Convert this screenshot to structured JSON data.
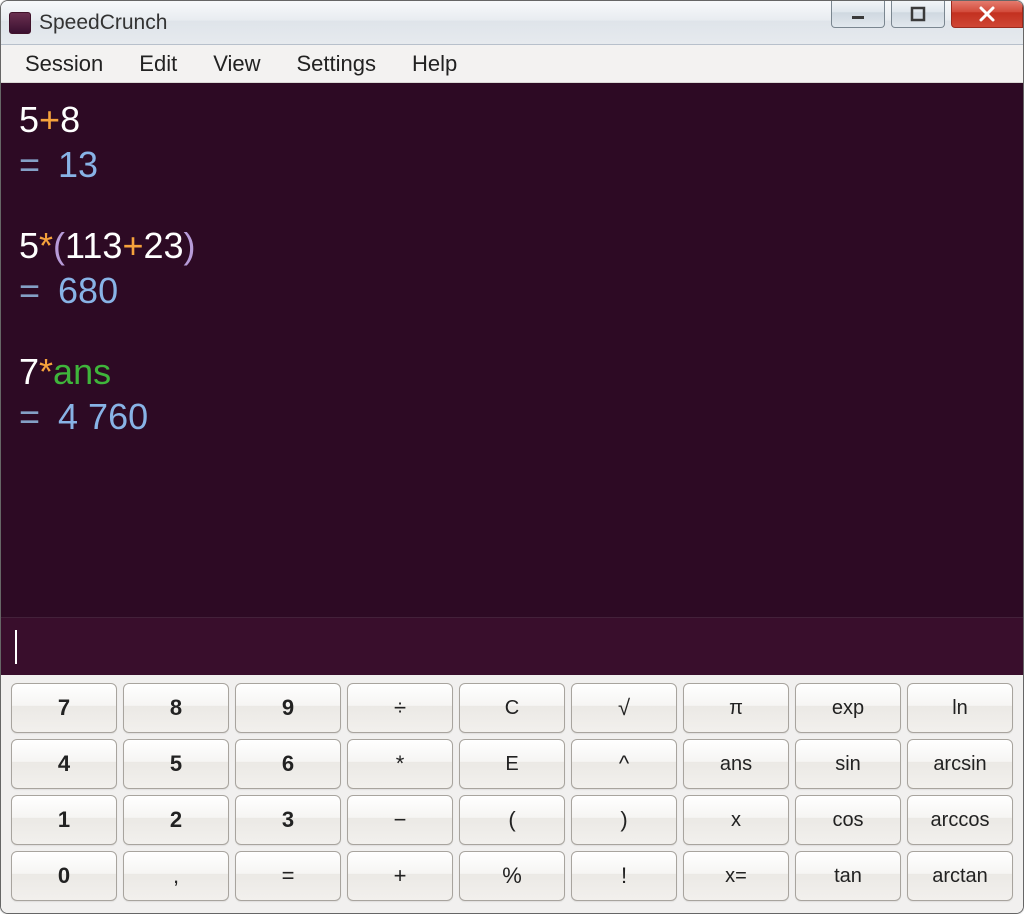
{
  "window": {
    "title": "SpeedCrunch"
  },
  "menubar": [
    "Session",
    "Edit",
    "View",
    "Settings",
    "Help"
  ],
  "history": [
    {
      "expr": [
        {
          "kind": "num",
          "text": "5"
        },
        {
          "kind": "op",
          "text": "+"
        },
        {
          "kind": "num",
          "text": "8"
        }
      ],
      "result": "13"
    },
    {
      "expr": [
        {
          "kind": "num",
          "text": "5"
        },
        {
          "kind": "op",
          "text": "*"
        },
        {
          "kind": "par",
          "text": "("
        },
        {
          "kind": "num",
          "text": "113"
        },
        {
          "kind": "op",
          "text": "+"
        },
        {
          "kind": "num",
          "text": "23"
        },
        {
          "kind": "par",
          "text": ")"
        }
      ],
      "result": "680"
    },
    {
      "expr": [
        {
          "kind": "num",
          "text": "7"
        },
        {
          "kind": "op",
          "text": "*"
        },
        {
          "kind": "var",
          "text": "ans"
        }
      ],
      "result": "4 760"
    }
  ],
  "input": "",
  "keypad": [
    [
      {
        "label": "7",
        "name": "key-7",
        "cls": "num"
      },
      {
        "label": "8",
        "name": "key-8",
        "cls": "num"
      },
      {
        "label": "9",
        "name": "key-9",
        "cls": "num"
      },
      {
        "label": "÷",
        "name": "key-divide",
        "cls": "op"
      },
      {
        "label": "C",
        "name": "key-clear",
        "cls": "fn"
      },
      {
        "label": "√",
        "name": "key-sqrt",
        "cls": "op"
      },
      {
        "label": "π",
        "name": "key-pi",
        "cls": "fn"
      },
      {
        "label": "exp",
        "name": "key-exp",
        "cls": "fn"
      },
      {
        "label": "ln",
        "name": "key-ln",
        "cls": "fn"
      }
    ],
    [
      {
        "label": "4",
        "name": "key-4",
        "cls": "num"
      },
      {
        "label": "5",
        "name": "key-5",
        "cls": "num"
      },
      {
        "label": "6",
        "name": "key-6",
        "cls": "num"
      },
      {
        "label": "*",
        "name": "key-multiply",
        "cls": "op"
      },
      {
        "label": "E",
        "name": "key-e",
        "cls": "fn"
      },
      {
        "label": "^",
        "name": "key-power",
        "cls": "op"
      },
      {
        "label": "ans",
        "name": "key-ans",
        "cls": "fn"
      },
      {
        "label": "sin",
        "name": "key-sin",
        "cls": "fn"
      },
      {
        "label": "arcsin",
        "name": "key-arcsin",
        "cls": "fn"
      }
    ],
    [
      {
        "label": "1",
        "name": "key-1",
        "cls": "num"
      },
      {
        "label": "2",
        "name": "key-2",
        "cls": "num"
      },
      {
        "label": "3",
        "name": "key-3",
        "cls": "num"
      },
      {
        "label": "−",
        "name": "key-minus",
        "cls": "op"
      },
      {
        "label": "(",
        "name": "key-lparen",
        "cls": "op"
      },
      {
        "label": ")",
        "name": "key-rparen",
        "cls": "op"
      },
      {
        "label": "x",
        "name": "key-x",
        "cls": "fn"
      },
      {
        "label": "cos",
        "name": "key-cos",
        "cls": "fn"
      },
      {
        "label": "arccos",
        "name": "key-arccos",
        "cls": "fn"
      }
    ],
    [
      {
        "label": "0",
        "name": "key-0",
        "cls": "num"
      },
      {
        "label": ",",
        "name": "key-comma",
        "cls": "op"
      },
      {
        "label": "=",
        "name": "key-equals",
        "cls": "op"
      },
      {
        "label": "+",
        "name": "key-plus",
        "cls": "op"
      },
      {
        "label": "%",
        "name": "key-percent",
        "cls": "op"
      },
      {
        "label": "!",
        "name": "key-factorial",
        "cls": "op"
      },
      {
        "label": "x=",
        "name": "key-assign",
        "cls": "fn"
      },
      {
        "label": "tan",
        "name": "key-tan",
        "cls": "fn"
      },
      {
        "label": "arctan",
        "name": "key-arctan",
        "cls": "fn"
      }
    ]
  ]
}
